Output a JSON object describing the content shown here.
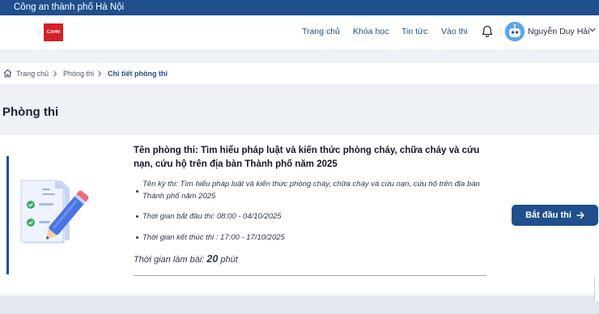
{
  "topbar": {
    "org": "Công an thành phố Hà Nội"
  },
  "header": {
    "logo_text": "CAHN",
    "nav": [
      "Trang chủ",
      "Khóa học",
      "Tin tức",
      "Vào thi"
    ],
    "user_name": "Nguyễn Duy Hải",
    "icons": [
      "bell-icon",
      "avatar",
      "chevron-down-icon"
    ]
  },
  "breadcrumb": {
    "items": [
      "Trang chủ",
      "Phòng thi",
      "Chi tiết phòng thi"
    ]
  },
  "page": {
    "title": "Phòng thi"
  },
  "exam": {
    "title": "Tên phòng thi: Tìm hiểu pháp luật và kiến thức phòng cháy, chữa cháy và cứu nạn, cứu hộ trên địa bàn Thành phố năm 2025",
    "term": "Tên kỳ thi: Tìm hiểu pháp luật và kiến thức phòng cháy, chữa cháy và cứu nạn, cứu hộ trên địa bàn Thành phố năm 2025",
    "start_time": "Thời gian bắt đầu thi: 08:00 - 04/10/2025",
    "end_time": "Thời gian kết thúc thi : 17:00 - 17/10/2025",
    "duration_label": "Thời gian làm bài:",
    "duration_value": "20",
    "duration_unit": "phút",
    "start_button": "Bắt đầu thi"
  },
  "colors": {
    "primary": "#1f4f8c",
    "logo_red": "#d42027",
    "background": "#eef1f6"
  }
}
